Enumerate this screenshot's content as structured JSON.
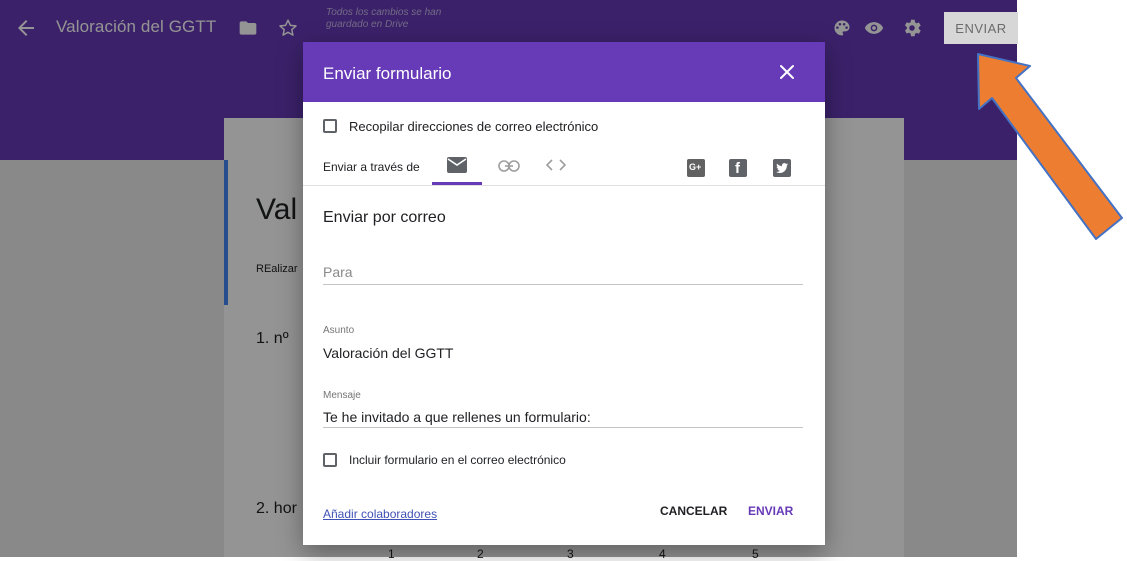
{
  "app": {
    "title": "Valoración del GGTT",
    "save_status": "Todos los cambios se han guardado en Drive",
    "send_label": "ENVIAR",
    "accent": "#673ab7"
  },
  "background_form": {
    "title": "Val",
    "description": "REalizar",
    "question1": "1. nº",
    "question2": "2. hor",
    "scale": [
      "1",
      "2",
      "3",
      "4",
      "5"
    ]
  },
  "dialog": {
    "title": "Enviar formulario",
    "collect_emails_label": "Recopilar direcciones de correo electrónico",
    "send_via_label": "Enviar a través de",
    "tabs": [
      "email-icon",
      "link-icon",
      "embed-icon"
    ],
    "social": [
      "google-plus-icon",
      "facebook-icon",
      "twitter-icon"
    ],
    "social_text": {
      "gplus": "G+",
      "facebook": "f"
    },
    "section_title": "Enviar por correo",
    "to_placeholder": "Para",
    "subject_label": "Asunto",
    "subject_value": "Valoración del GGTT",
    "message_label": "Mensaje",
    "message_value": "Te he invitado a que rellenes un formulario:",
    "include_form_label": "Incluir formulario en el correo electrónico",
    "add_collaborators": "Añadir colaboradores",
    "cancel_label": "CANCELAR",
    "send_label": "ENVIAR"
  },
  "annotation": {
    "arrow_color": "#ed7d31"
  }
}
